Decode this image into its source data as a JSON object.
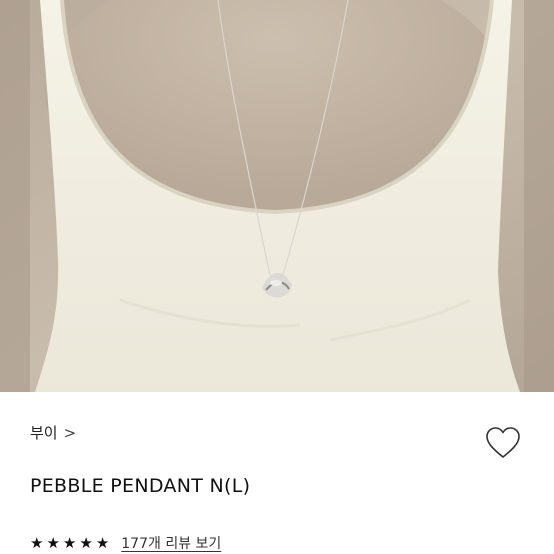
{
  "product": {
    "brand": "부이",
    "brand_chevron": ">",
    "title": "PEBBLE PENDANT N(L)",
    "rating": 5,
    "stars": [
      "★",
      "★",
      "★",
      "★",
      "★"
    ],
    "review_link": "177개 리뷰 보기"
  },
  "icons": {
    "brand_chevron": "chevron-right-icon",
    "wishlist": "heart-outline-icon",
    "star": "star-filled-icon"
  },
  "colors": {
    "top": "#f3f0e4",
    "skin": "#c2b4a4",
    "background": "#ffffff",
    "text": "#111111"
  }
}
